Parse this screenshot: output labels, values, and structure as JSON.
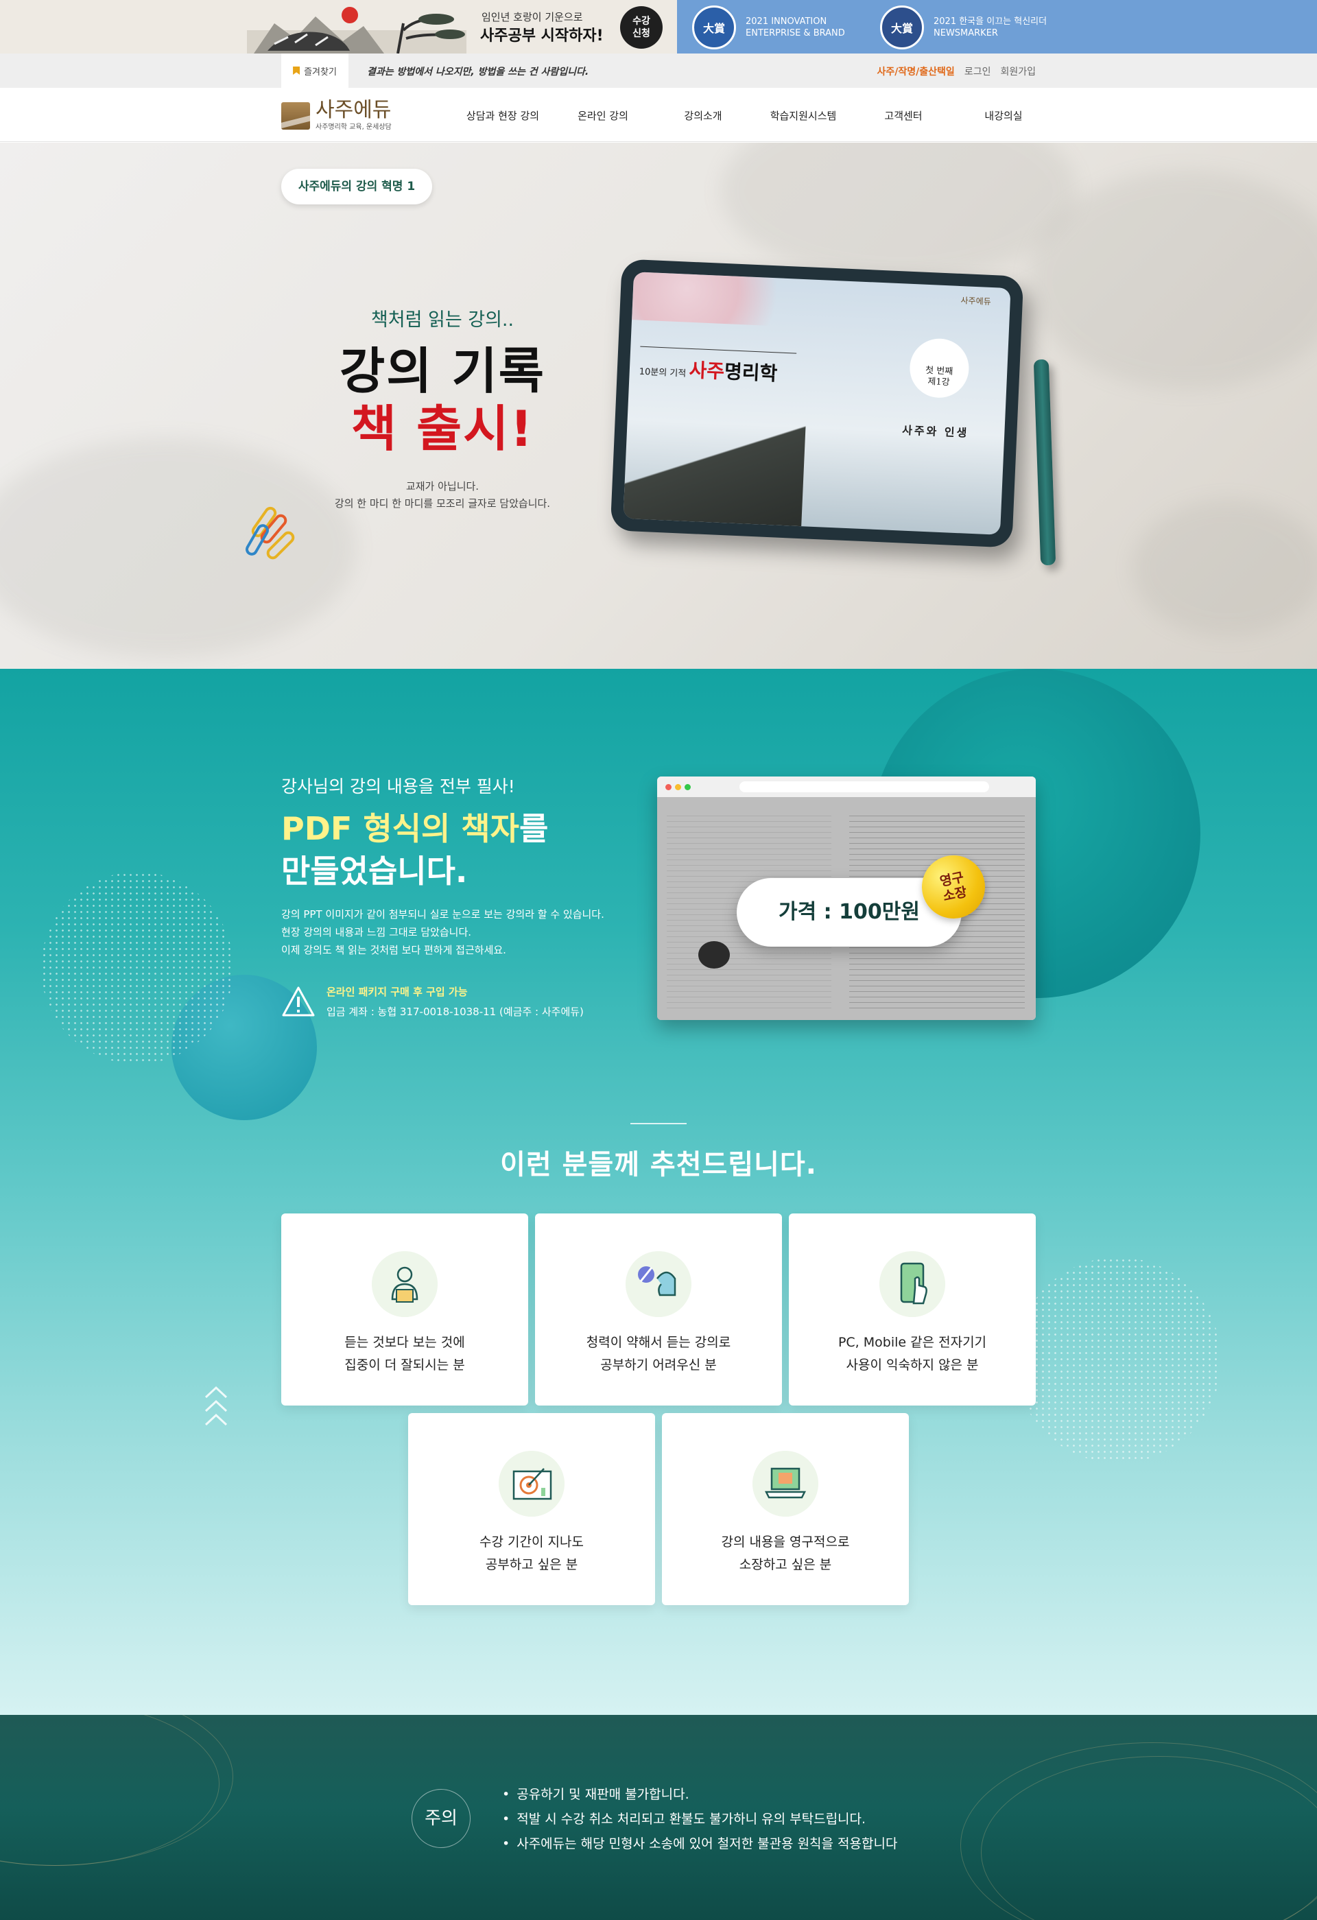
{
  "promo": {
    "line1": "임인년 호랑이 기운으로",
    "line2": "사주공부 시작하자!",
    "enroll_button": "수강\n신청",
    "award1_seal": "大賞",
    "award1_line1": "2021 INNOVATION",
    "award1_line2": "ENTERPRISE & BRAND",
    "award2_seal": "大賞",
    "award2_line1": "2021 한국을 이끄는 혁신리더",
    "award2_line2": "NEWSMARKER"
  },
  "util": {
    "bookmark": "즐겨찾기",
    "slogan": "결과는 방법에서 나오지만, 방법을 쓰는 건 사람입니다.",
    "link_highlight": "사주/작명/출산택일",
    "login": "로그인",
    "join": "회원가입"
  },
  "nav": {
    "logo_name": "사주에듀",
    "logo_sub": "사주명리학 교육, 운세상담",
    "items": [
      "상담과 현장 강의",
      "온라인 강의",
      "강의소개",
      "학습지원시스템",
      "고객센터",
      "내강의실"
    ]
  },
  "hero": {
    "pill": "사주에듀의 강의 혁명 1",
    "kicker": "책처럼 읽는 강의..",
    "title1": "강의 기록",
    "title2": "책 출시!",
    "desc1": "교재가 아닙니다.",
    "desc2": "강의 한 마디 한 마디를 모조리 글자로 담았습니다.",
    "screen_brand": "사주에듀",
    "screen_prefix": "10분의 기적",
    "screen_title_red": "사주",
    "screen_title_black": "명리학",
    "screen_seal_line1": "첫 번째",
    "screen_seal_line2": "제1강",
    "screen_sub": "사주와 인생"
  },
  "pdf": {
    "kicker": "강사님의 강의 내용을 전부 필사!",
    "title_highlight": "PDF 형식의 책자",
    "title_rest1": "를",
    "title_rest2": "만들었습니다.",
    "desc1": "강의 PPT 이미지가 같이 첨부되니 실로 눈으로 보는 강의라 할 수 있습니다.",
    "desc2": "현장 강의의 내용과 느낌 그대로 담았습니다.",
    "desc3": "이제 강의도 책 읽는 것처럼 보다 편하게 접근하세요.",
    "notice_highlight": "온라인 패키지 구매 후 구입 가능",
    "notice_account": "입금 계좌 : 농협 317-0018-1038-11 (예금주 : 사주에듀)",
    "price": "가격 : 100만원",
    "forever_badge": "영구\n소장"
  },
  "recommend": {
    "title": "이런 분들께 추천드립니다.",
    "cards": [
      {
        "icon": "reading-person-icon",
        "line1": "듣는 것보다 보는 것에",
        "line2": "집중이 더 잘되시는 분"
      },
      {
        "icon": "hearing-impaired-icon",
        "line1": "청력이 약해서 듣는 강의로",
        "line2": "공부하기 어려우신 분"
      },
      {
        "icon": "tablet-touch-icon",
        "line1": "PC, Mobile 같은 전자기기",
        "line2": "사용이 익숙하지 않은 분"
      },
      {
        "icon": "target-chart-icon",
        "line1": "수강 기간이 지나도",
        "line2": "공부하고 싶은 분"
      },
      {
        "icon": "laptop-book-icon",
        "line1": "강의 내용을 영구적으로",
        "line2": "소장하고 싶은 분"
      }
    ]
  },
  "caution": {
    "label": "주의",
    "items": [
      "공유하기 및 재판매 불가합니다.",
      "적발 시 수강 취소 처리되고 환불도 불가하니 유의 부탁드립니다.",
      "사주에듀는 해당 민형사 소송에 있어 철저한 불관용 원칙을 적용합니다"
    ]
  },
  "colors": {
    "teal": "#13a3a2",
    "dark_green": "#155f5a",
    "accent_red": "#d3171f",
    "accent_yellow": "#fff38a",
    "util_orange": "#e06a1b"
  }
}
